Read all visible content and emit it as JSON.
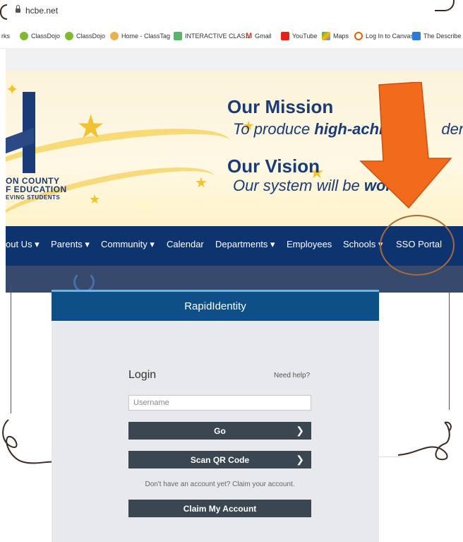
{
  "browser": {
    "url": "hcbe.net",
    "bookmarks": [
      {
        "label": "rks",
        "color": "#ffffff"
      },
      {
        "label": "ClassDojo",
        "color": "#7fba2c"
      },
      {
        "label": "ClassDojo",
        "color": "#7fba2c"
      },
      {
        "label": "Home - ClassTag",
        "color": "#e8b34a"
      },
      {
        "label": "INTERACTIVE CLAS...",
        "color": "#5ab56a"
      },
      {
        "label": "Gmail",
        "color": "#d93025"
      },
      {
        "label": "YouTube",
        "color": "#e62117"
      },
      {
        "label": "Maps",
        "color": "#34a853"
      },
      {
        "label": "Log In to Canvas",
        "color": "#e66000"
      },
      {
        "label": "The Describe",
        "color": "#2a7ad6"
      }
    ]
  },
  "banner": {
    "mission_title": "Our Mission",
    "mission_text_a": "To produce ",
    "mission_text_b": "high-achie",
    "mission_text_c": "dents",
    "vision_title": "Our Vision",
    "vision_text_a": "Our system will be ",
    "vision_text_b": "worl",
    "county_line1": "ON COUNTY",
    "county_line2": "F EDUCATION",
    "county_line3": "EVING STUDENTS"
  },
  "nav": {
    "items": [
      {
        "label": "out Us ▾"
      },
      {
        "label": "Parents ▾"
      },
      {
        "label": "Community ▾"
      },
      {
        "label": "Calendar"
      },
      {
        "label": "Departments ▾"
      },
      {
        "label": "Employees"
      },
      {
        "label": "Schools ▾"
      },
      {
        "label": "SSO Portal"
      }
    ]
  },
  "login": {
    "header": "RapidIdentity",
    "title": "Login",
    "help_link": "Need help?",
    "username_placeholder": "Username",
    "go_label": "Go",
    "scan_label": "Scan QR Code",
    "claim_text": "Don't have an account yet? Claim your account.",
    "claim_button": "Claim My Account"
  },
  "annotation": {
    "arrow_color": "#f26a1b",
    "circle_color": "#a86a3a",
    "icon": "down-arrow-icon"
  }
}
